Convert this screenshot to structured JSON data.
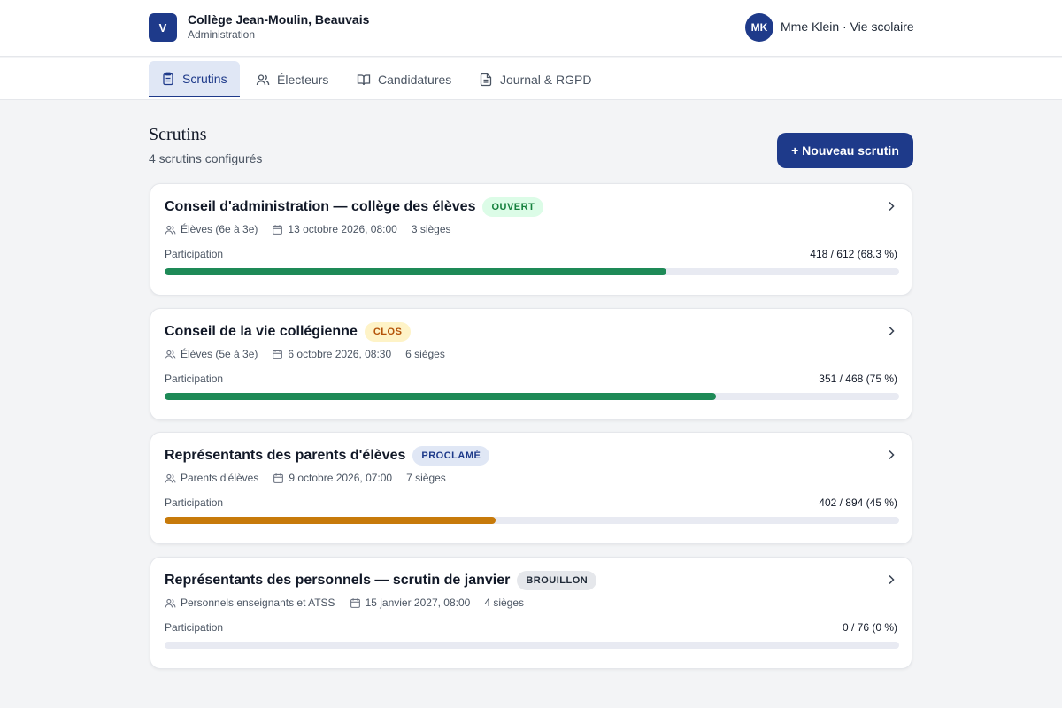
{
  "header": {
    "logo_letter": "V",
    "org_name": "Collège Jean-Moulin, Beauvais",
    "org_sub": "Administration",
    "avatar_initials": "MK",
    "user_label": "Mme Klein · Vie scolaire"
  },
  "tabs": [
    {
      "label": "Scrutins",
      "icon": "clipboard-icon",
      "active": true
    },
    {
      "label": "Électeurs",
      "icon": "users-icon",
      "active": false
    },
    {
      "label": "Candidatures",
      "icon": "book-open-icon",
      "active": false
    },
    {
      "label": "Journal & RGPD",
      "icon": "file-text-icon",
      "active": false
    }
  ],
  "main": {
    "title": "Scrutins",
    "subtitle": "4 scrutins configurés",
    "new_button_label": "+ Nouveau scrutin"
  },
  "colors": {
    "accent": "#1e3a8a",
    "progress_green": "#1e8a57",
    "progress_amber": "#c77a0a"
  },
  "elections": [
    {
      "title": "Conseil d'administration — collège des élèves",
      "status": "OUVERT",
      "status_kind": "open",
      "electorate": "Élèves (6e à 3e)",
      "date": "13 octobre 2026, 08:00",
      "seats": "3 sièges",
      "participation_label": "Participation",
      "participation_value": "418 / 612 (68.3 %)",
      "participation_fraction": 0.683,
      "bar_color": "#1e8a57"
    },
    {
      "title": "Conseil de la vie collégienne",
      "status": "CLOS",
      "status_kind": "closed",
      "electorate": "Élèves (5e à 3e)",
      "date": "6 octobre 2026, 08:30",
      "seats": "6 sièges",
      "participation_label": "Participation",
      "participation_value": "351 / 468 (75 %)",
      "participation_fraction": 0.75,
      "bar_color": "#1e8a57"
    },
    {
      "title": "Représentants des parents d'élèves",
      "status": "PROCLAMÉ",
      "status_kind": "proclaimed",
      "electorate": "Parents d'élèves",
      "date": "9 octobre 2026, 07:00",
      "seats": "7 sièges",
      "participation_label": "Participation",
      "participation_value": "402 / 894 (45 %)",
      "participation_fraction": 0.45,
      "bar_color": "#c77a0a"
    },
    {
      "title": "Représentants des personnels — scrutin de janvier",
      "status": "BROUILLON",
      "status_kind": "draft",
      "electorate": "Personnels enseignants et ATSS",
      "date": "15 janvier 2027, 08:00",
      "seats": "4 sièges",
      "participation_label": "Participation",
      "participation_value": "0 / 76 (0 %)",
      "participation_fraction": 0,
      "bar_color": "#1e8a57"
    }
  ]
}
